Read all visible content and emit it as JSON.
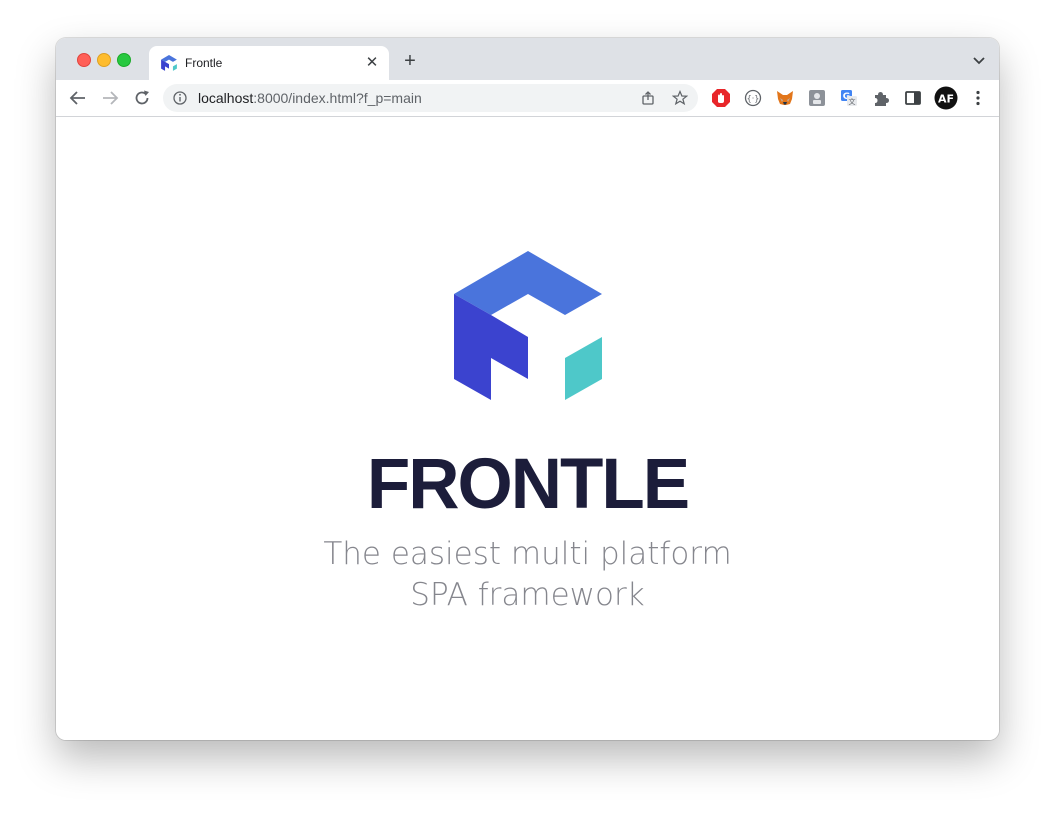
{
  "browser": {
    "tab": {
      "title": "Frontle",
      "close_glyph": "✕"
    },
    "new_tab_glyph": "+",
    "address": {
      "host": "localhost",
      "path": ":8000/index.html?f_p=main"
    },
    "extensions": [
      "adblock-icon",
      "json-viewer-icon",
      "metamask-icon",
      "reader-icon",
      "google-translate-icon",
      "puzzle-icon",
      "side-panel-icon",
      "profile-avatar-icon"
    ],
    "profile_initials": "AF"
  },
  "page": {
    "brand": "FRONTLE",
    "tagline_line1": "The easiest multi platform",
    "tagline_line2": "SPA framework"
  },
  "colors": {
    "logo_top": "#4a74dc",
    "logo_left": "#3b43cf",
    "logo_right": "#4ec8c9",
    "brand_text": "#1c1d3a",
    "tagline_text": "#85868d"
  }
}
